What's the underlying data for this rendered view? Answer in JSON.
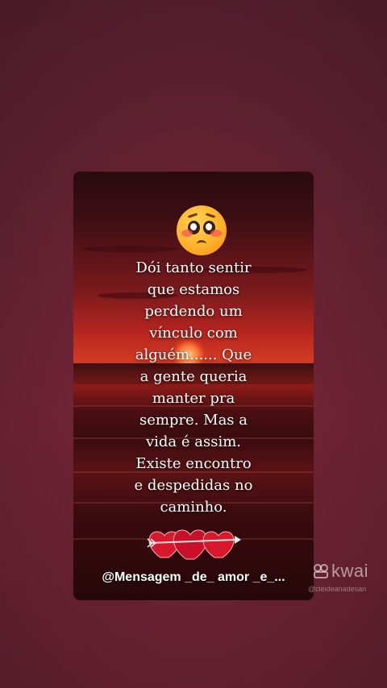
{
  "post": {
    "message_lines": [
      "Dói tanto sentir",
      "que estamos",
      "perdendo um",
      "vínculo com",
      "alguém...... Que",
      "a gente queria",
      "manter pra",
      "sempre. Mas a",
      "vida é assim.",
      "Existe encontro",
      "e despedidas no",
      "caminho."
    ],
    "handle": "@Mensagem _de_ amor _e_...",
    "top_icon": "pleading-face-icon",
    "bottom_icon": "hearts-with-arrow-icon"
  },
  "watermark": {
    "brand": "kwai",
    "user": "@cleideanadesan",
    "icon": "kwai-logo-icon"
  },
  "colors": {
    "background": "#6a2637",
    "text": "#ffffff",
    "heart": "#d8182c"
  }
}
